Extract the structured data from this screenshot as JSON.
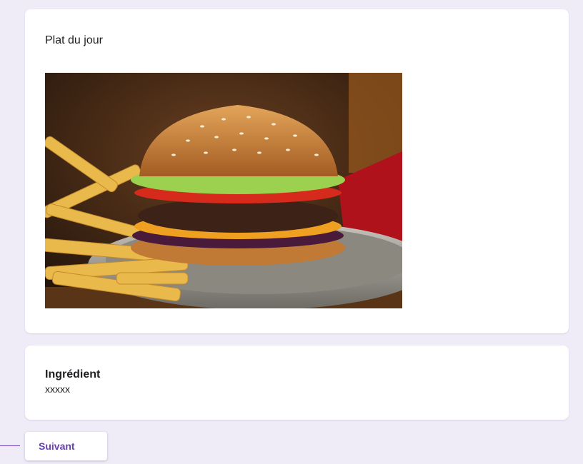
{
  "question": {
    "title": "Plat du jour",
    "image_alt": "Hamburger au fromage avec frites"
  },
  "ingredient": {
    "title": "Ingrédient",
    "value": "xxxxx"
  },
  "navigation": {
    "next_label": "Suivant"
  },
  "colors": {
    "background": "#efebf7",
    "accent": "#6a3fb5"
  }
}
